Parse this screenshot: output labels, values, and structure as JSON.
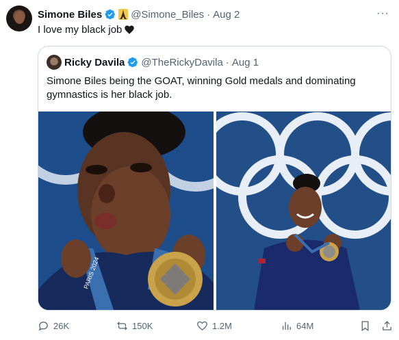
{
  "tweet": {
    "author_name": "Simone Biles",
    "author_handle": "@Simone_Biles",
    "separator": "·",
    "date": "Aug 2",
    "text": "I love my black job",
    "more": "···"
  },
  "quote": {
    "author_name": "Ricky Davila",
    "author_handle": "@TheRickyDavila",
    "separator": "·",
    "date": "Aug 1",
    "text": "Simone Biles being the GOAT, winning Gold medals and dominating gymnastics is her black job.",
    "lanyard_text": "PARIS 2024"
  },
  "actions": {
    "replies": "26K",
    "reposts": "150K",
    "likes": "1.2M",
    "views": "64M"
  },
  "colors": {
    "verified": "#1d9bf0",
    "secondary_text": "#536471",
    "border": "#cfd9de",
    "photo_blue": "#1e4d8c",
    "gold": "#c9a24a"
  }
}
